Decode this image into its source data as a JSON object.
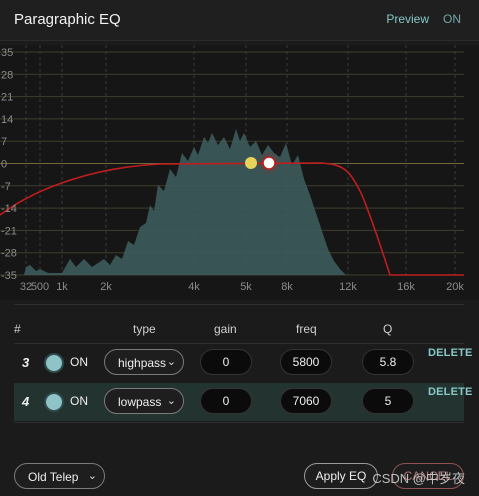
{
  "header": {
    "title": "Paragraphic EQ",
    "preview_label": "Preview",
    "preview_state": "ON"
  },
  "graph": {
    "y_ticks": [
      35,
      28,
      21,
      14,
      7,
      0,
      -7,
      -14,
      -21,
      -28,
      -35
    ],
    "x_ticks": [
      "32",
      "500",
      "1k",
      "2k",
      "4k",
      "5k",
      "8k",
      "12k",
      "16k",
      "20k"
    ],
    "curve_color": "#c11d1d",
    "spectrum_color": "#3d5b5b",
    "band_handles": [
      {
        "band": "3",
        "color": "#e6d45a"
      },
      {
        "band": "4",
        "color": "#ffffff"
      }
    ]
  },
  "table": {
    "headers": {
      "num": "#",
      "type": "type",
      "gain": "gain",
      "freq": "freq",
      "q": "Q"
    },
    "rows": [
      {
        "num": "3",
        "on_label": "ON",
        "type": "highpass",
        "gain": "0",
        "freq": "5800",
        "q": "5.8",
        "delete": "DELETE"
      },
      {
        "num": "4",
        "on_label": "ON",
        "type": "lowpass",
        "gain": "0",
        "freq": "7060",
        "q": "5",
        "delete": "DELETE"
      }
    ]
  },
  "footer": {
    "preset": "Old Telep",
    "apply_label": "Apply EQ",
    "cancel_label": "CANCEL",
    "watermark": "CSDN @中岁夜"
  }
}
